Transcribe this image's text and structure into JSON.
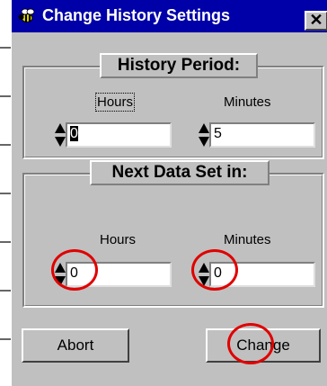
{
  "window": {
    "title": "Change History Settings",
    "close_label": "✕",
    "icon": "bee-app-icon"
  },
  "history_period": {
    "title": "History Period:",
    "hours_label": "Hours",
    "minutes_label": "Minutes",
    "hours_value": "0",
    "minutes_value": "5"
  },
  "next_data_set": {
    "title": "Next Data Set in:",
    "hours_label": "Hours",
    "minutes_label": "Minutes",
    "hours_value": "0",
    "minutes_value": "0"
  },
  "buttons": {
    "abort": "Abort",
    "change": "Change"
  },
  "colors": {
    "titlebar": "#0000a8",
    "dialog_face": "#c0c0c0",
    "annotation": "#e00000"
  }
}
